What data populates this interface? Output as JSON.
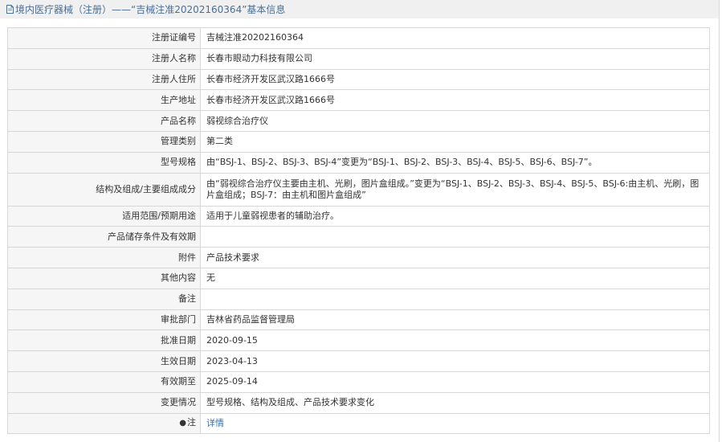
{
  "header": {
    "title": "境内医疗器械（注册）——“吉械注准20202160364”基本信息",
    "icon": "document-icon"
  },
  "rows": [
    {
      "label": "注册证编号",
      "value": "吉械注准20202160364"
    },
    {
      "label": "注册人名称",
      "value": "长春市眼动力科技有限公司"
    },
    {
      "label": "注册人住所",
      "value": "长春市经济开发区武汉路1666号"
    },
    {
      "label": "生产地址",
      "value": "长春市经济开发区武汉路1666号"
    },
    {
      "label": "产品名称",
      "value": "弱视综合治疗仪"
    },
    {
      "label": "管理类别",
      "value": "第二类"
    },
    {
      "label": "型号规格",
      "value": "由“BSJ-1、BSJ-2、BSJ-3、BSJ-4”变更为“BSJ-1、BSJ-2、BSJ-3、BSJ-4、BSJ-5、BSJ-6、BSJ-7”。"
    },
    {
      "label": "结构及组成/主要组成成分",
      "value": "由“弱视综合治疗仪主要由主机、光刷，图片盒组成。”变更为“BSJ-1、BSJ-2、BSJ-3、BSJ-4、BSJ-5、BSJ-6:由主机、光刷，图片盒组成；BSJ-7：由主机和图片盒组成”"
    },
    {
      "label": "适用范围/预期用途",
      "value": "适用于儿童弱视患者的辅助治疗。"
    },
    {
      "label": "产品储存条件及有效期",
      "value": ""
    },
    {
      "label": "附件",
      "value": "产品技术要求"
    },
    {
      "label": "其他内容",
      "value": "无"
    },
    {
      "label": "备注",
      "value": ""
    },
    {
      "label": "审批部门",
      "value": "吉林省药品监督管理局"
    },
    {
      "label": "批准日期",
      "value": "2020-09-15"
    },
    {
      "label": "生效日期",
      "value": "2023-04-13"
    },
    {
      "label": "有效期至",
      "value": "2025-09-14"
    },
    {
      "label": "变更情况",
      "value": "型号规格、结构及组成、产品技术要求变化"
    }
  ],
  "note": {
    "bullet": "●",
    "label": "注",
    "link_text": "详情"
  },
  "colors": {
    "header_bg": "#f0f0f0",
    "header_text": "#4a6f96",
    "label_bg": "#f6f6f6",
    "border": "#d7d7d7",
    "link": "#2f6fb5"
  }
}
